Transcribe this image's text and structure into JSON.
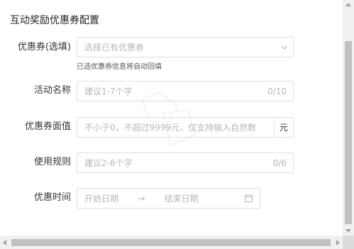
{
  "form": {
    "title": "互动奖励优惠券配置",
    "coupon": {
      "label": "优惠券(选填)",
      "placeholder": "选择已有优惠券",
      "hint": "已选优惠券信息将自动回填"
    },
    "activity_name": {
      "label": "活动名称",
      "placeholder": "建议1-7个字",
      "counter": "0/10"
    },
    "face_value": {
      "label": "优惠券面值",
      "placeholder": "不小于0，不超过9999元，仅支持输入自然数",
      "unit": "元"
    },
    "usage_rules": {
      "label": "使用规则",
      "placeholder": "建议2-6个字",
      "counter": "0/6"
    },
    "time": {
      "label": "优惠时间",
      "start_placeholder": "开始日期",
      "separator": "→",
      "end_placeholder": "结束日期"
    }
  },
  "icons": {
    "dropdown": "chevron-down-icon",
    "calendar": "calendar-icon"
  },
  "colors": {
    "border": "#dcdfe6",
    "placeholder": "#b4b7bd",
    "text": "#333333"
  }
}
